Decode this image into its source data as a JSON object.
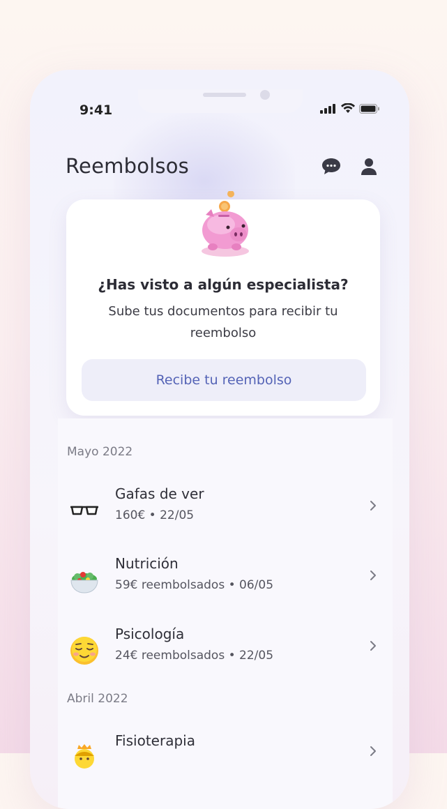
{
  "status_bar": {
    "time": "9:41"
  },
  "header": {
    "title": "Reembolsos"
  },
  "promo_card": {
    "title": "¿Has visto a algún especialista?",
    "text": "Sube tus documentos para recibir  tu reembolso",
    "button_label": "Recibe tu reembolso"
  },
  "sections": [
    {
      "label": "Mayo 2022",
      "items": [
        {
          "name": "Gafas de ver",
          "meta": "160€ • 22/05",
          "icon": "glasses-icon"
        },
        {
          "name": "Nutrición",
          "meta": "59€ reembolsados • 06/05",
          "icon": "salad-icon"
        },
        {
          "name": "Psicología",
          "meta": "24€ reembolsados • 22/05",
          "icon": "relieved-face-icon"
        }
      ]
    },
    {
      "label": "Abril 2022",
      "items": [
        {
          "name": "Fisioterapia",
          "meta": "",
          "icon": "person-icon"
        }
      ]
    }
  ],
  "colors": {
    "accent": "#5463b6",
    "button_bg": "#eeeef9",
    "title": "#2c2c35"
  }
}
